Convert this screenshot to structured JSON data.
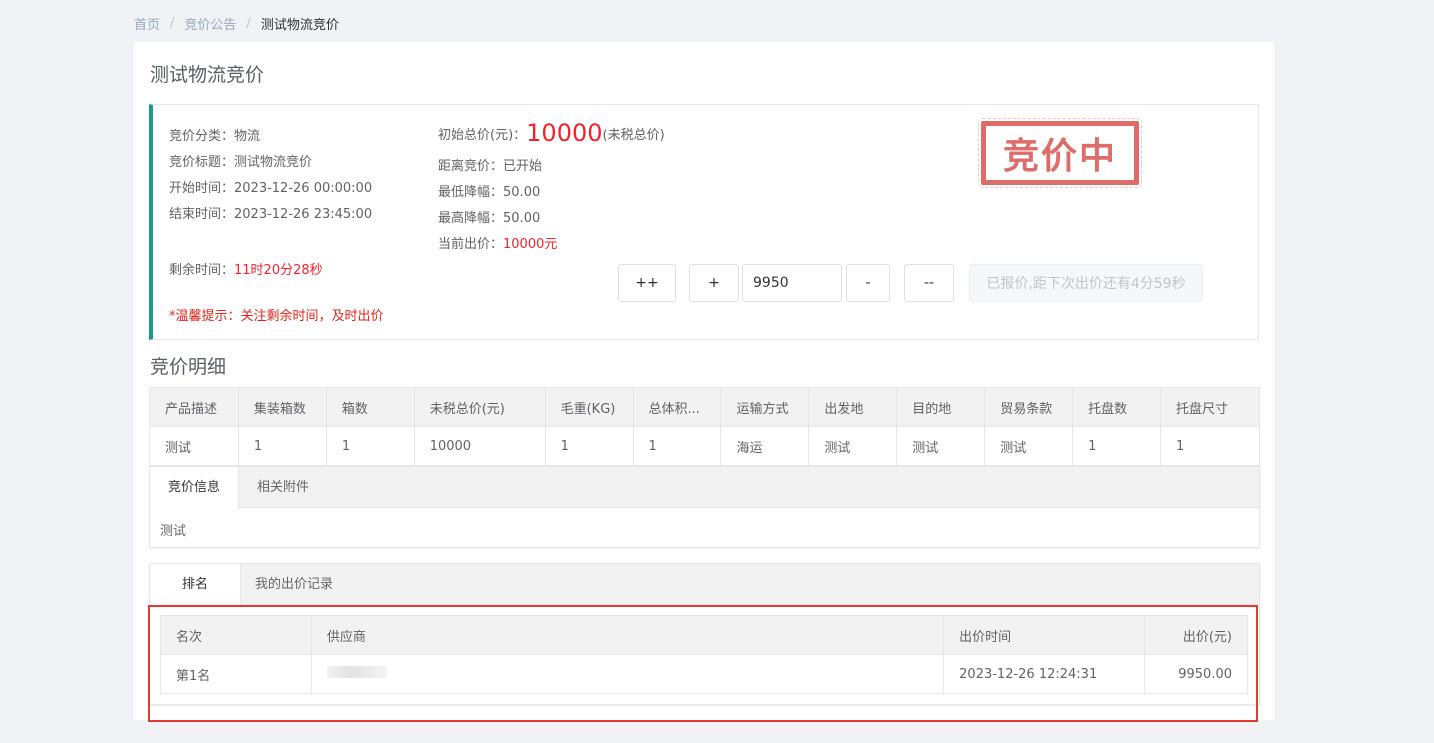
{
  "breadcrumb": {
    "home": "首页",
    "list": "竞价公告",
    "current": "测试物流竞价",
    "sep": "/"
  },
  "page_title": "测试物流竞价",
  "info": {
    "category_label": "竞价分类：",
    "category": "物流",
    "title_label": "竞价标题：",
    "title": "测试物流竞价",
    "start_label": "开始时间：",
    "start": "2023-12-26 00:00:00",
    "end_label": "结束时间：",
    "end": "2023-12-26 23:45:00",
    "remaining_label": "剩余时间：",
    "remaining": "11时20分28秒",
    "tip": "*温馨提示：关注剩余时间，及时出价",
    "initial_price_label": "初始总价(元)：",
    "initial_price": "10000",
    "initial_price_note": "(未税总价)",
    "distance_label": "距离竞价：",
    "distance": "已开始",
    "min_drop_label": "最低降幅：",
    "min_drop": "50.00",
    "max_drop_label": "最高降幅：",
    "max_drop": "50.00",
    "current_bid_label": "当前出价：",
    "current_bid": "10000元",
    "stamp": "竞价中"
  },
  "bid_controls": {
    "double_plus": "++",
    "plus": "+",
    "price_value": "9950",
    "minus": "-",
    "double_minus": "--",
    "submit": "已报价,距下次出价还有4分59秒"
  },
  "detail_title": "竞价明细",
  "detail_table": {
    "headers": [
      "产品描述",
      "集装箱数",
      "箱数",
      "未税总价(元)",
      "毛重(KG)",
      "总体积...",
      "运输方式",
      "出发地",
      "目的地",
      "贸易条款",
      "托盘数",
      "托盘尺寸"
    ],
    "row": [
      "测试",
      "1",
      "1",
      "10000",
      "1",
      "1",
      "海运",
      "测试",
      "测试",
      "测试",
      "1",
      "1"
    ]
  },
  "info_tabs": {
    "tab1": "竞价信息",
    "tab2": "相关附件",
    "content": "测试"
  },
  "rank_tabs": {
    "tab1": "排名",
    "tab2": "我的出价记录"
  },
  "rank_table": {
    "headers": [
      "名次",
      "供应商",
      "出价时间",
      "出价(元)"
    ],
    "rows": [
      [
        "第1名",
        "",
        "2023-12-26 12:24:31",
        "9950.00"
      ]
    ]
  },
  "colors": {
    "accent": "#1a9c8c",
    "price_red": "#f5222d",
    "stamp_red": "#d9534f",
    "highlight": "#e53935"
  }
}
